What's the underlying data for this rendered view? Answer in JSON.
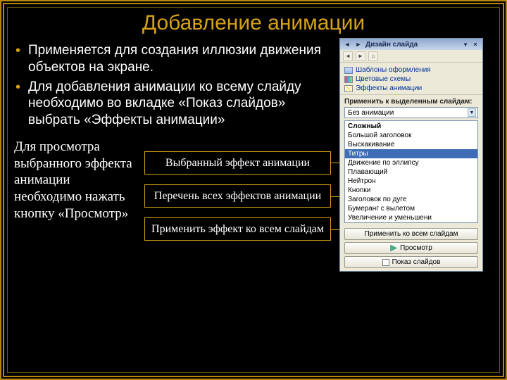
{
  "title": "Добавление анимации",
  "bullets": {
    "b1": "Применяется для создания иллюзии движения объектов на экране.",
    "b2": "Для добавления анимации ко всему слайду необходимо во вкладке «Показ слайдов» выбрать «Эффекты анимации»"
  },
  "lower_left": "Для просмотра выбранного эффекта анимации необходимо нажать кнопку «Просмотр»",
  "callouts": {
    "c1": "Выбранный эффект анимации",
    "c2": "Перечень всех эффектов анимации",
    "c3": "Применить эффект ко всем слайдам"
  },
  "pane": {
    "header_title": "Дизайн слайда",
    "links": {
      "templates": "Шаблоны оформления",
      "colors": "Цветовые схемы",
      "effects": "Эффекты анимации"
    },
    "section_label": "Применить к выделенным слайдам:",
    "dropdown_value": "Без анимации",
    "group_label": "Сложный",
    "items": {
      "i0": "Большой заголовок",
      "i1": "Выскакивание",
      "i2": "Титры",
      "i3": "Движение по эллипсу",
      "i4": "Плавающий",
      "i5": "Нейтрон",
      "i6": "Кнопки",
      "i7": "Заголовок по дуге",
      "i8": "Бумеранг с вылетом",
      "i9": "Увеличение и уменьшени"
    },
    "buttons": {
      "apply_all": "Применить ко всем слайдам",
      "preview": "Просмотр",
      "slideshow": "Показ слайдов"
    }
  }
}
